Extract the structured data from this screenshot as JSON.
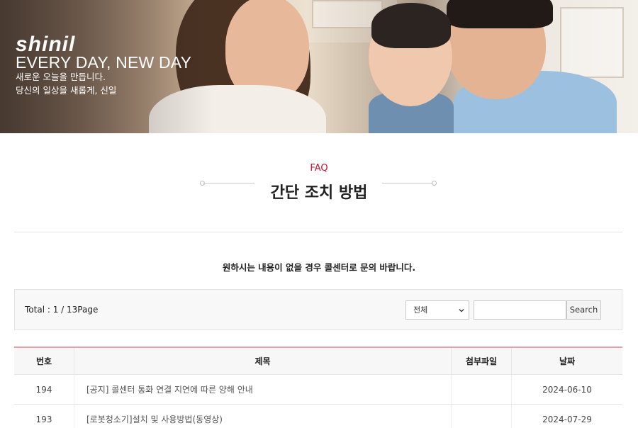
{
  "hero": {
    "brand": "shinil",
    "tagline": "EVERY DAY, NEW DAY",
    "subtitle_1": "새로운 오늘을 만듭니다.",
    "subtitle_2": "당신의 일상을 새롭게, 신일"
  },
  "section": {
    "label": "FAQ",
    "title": "간단 조치 방법",
    "notice": "원하시는 내용이 없을 경우 콜센터로 문의 바랍니다."
  },
  "search": {
    "total_text": "Total : 1 / 13Page",
    "select_value": "전체",
    "input_value": "",
    "button_label": "Search"
  },
  "table": {
    "headers": [
      "번호",
      "제목",
      "첨부파일",
      "날짜"
    ],
    "rows": [
      {
        "no": "194",
        "title": "[공지] 콜센터 통화 연결 지연에 따른 양해 안내",
        "attachment": "",
        "date": "2024-06-10"
      },
      {
        "no": "193",
        "title": "[로봇청소기]설치 및 사용방법(동영상)",
        "attachment": "",
        "date": "2024-07-29"
      }
    ]
  },
  "colors": {
    "accent": "#c8102e",
    "table_top_border": "#e8a0a8"
  },
  "icons": {
    "select": "chevron-down-icon"
  }
}
